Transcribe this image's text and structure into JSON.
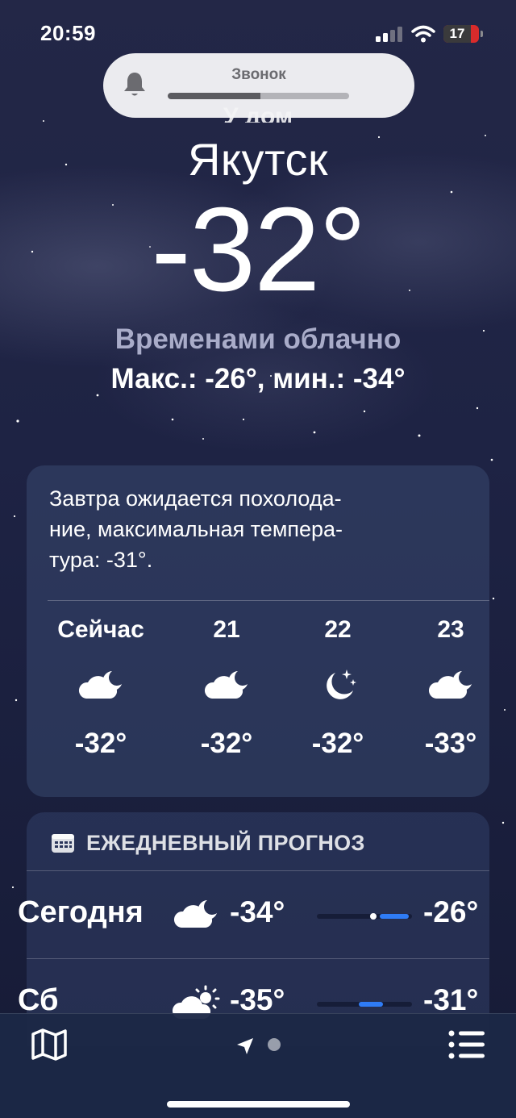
{
  "status_bar": {
    "time": "20:59",
    "battery_level": "17",
    "icons": [
      "cellular-signal-icon",
      "wifi-icon",
      "battery-icon"
    ]
  },
  "ringer_hud": {
    "label": "Звонок",
    "volume_fraction": 0.51,
    "icon": "bell-icon"
  },
  "hero": {
    "partial_text": "У дом",
    "city": "Якутск",
    "temperature": "-32°",
    "condition": "Временами облачно",
    "high_low": "Макс.: -26°, мин.: -34°"
  },
  "hourly": {
    "summary": "Завтра ожидается похолода-\nние, максимальная темпера-\nтура: -31°.",
    "items": [
      {
        "label": "Сейчас",
        "icon": "cloud-moon-icon",
        "temp": "-32°"
      },
      {
        "label": "21",
        "icon": "cloud-moon-icon",
        "temp": "-32°"
      },
      {
        "label": "22",
        "icon": "moon-stars-icon",
        "temp": "-32°"
      },
      {
        "label": "23",
        "icon": "cloud-moon-icon",
        "temp": "-33°"
      }
    ]
  },
  "daily": {
    "header": "ЕЖЕДНЕВНЫЙ ПРОГНОЗ",
    "header_icon": "calendar-icon",
    "range": [
      -35,
      -26
    ],
    "rows": [
      {
        "day": "Сегодня",
        "icon": "cloud-moon-icon",
        "low": "-34°",
        "high": "-26°",
        "low_value": -34,
        "high_value": -26,
        "current_value": -32
      },
      {
        "day": "Сб",
        "icon": "cloud-sun-icon",
        "low": "-35°",
        "high": "-31°",
        "low_value": -35,
        "high_value": -31
      }
    ]
  },
  "tabbar": {
    "icons": [
      "map-icon",
      "location-arrow-icon",
      "page-dot",
      "list-icon"
    ]
  },
  "colors": {
    "background": "#1e2344",
    "card": "#384870",
    "accent_bar": "#2f7cf6",
    "condition_text": "#a9acc9",
    "battery_low": "#d92b2b"
  }
}
